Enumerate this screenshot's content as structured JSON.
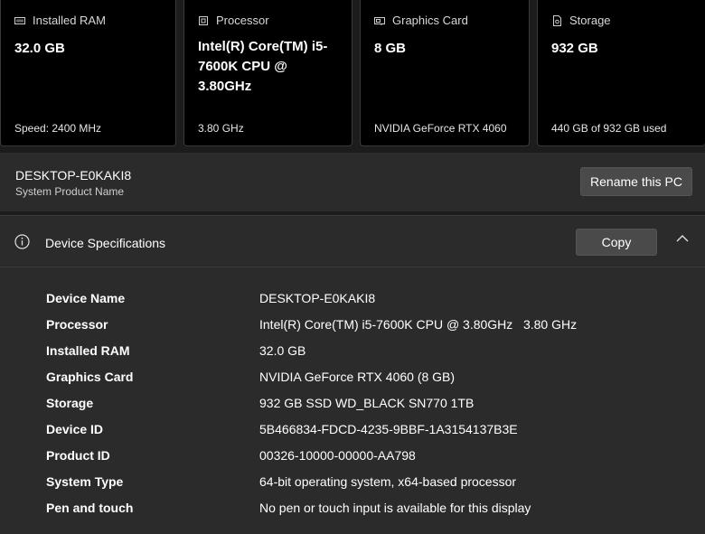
{
  "cards": [
    {
      "icon": "ram-icon",
      "title": "Installed RAM",
      "value": "32.0 GB",
      "footer": "Speed: 2400 MHz"
    },
    {
      "icon": "processor-icon",
      "title": "Processor",
      "value": "Intel(R) Core(TM) i5-7600K CPU @ 3.80GHz",
      "footer": "3.80 GHz"
    },
    {
      "icon": "graphics-card-icon",
      "title": "Graphics Card",
      "value": "8 GB",
      "footer": "NVIDIA GeForce RTX 4060"
    },
    {
      "icon": "storage-icon",
      "title": "Storage",
      "value": "932 GB",
      "footer": "440 GB of 932 GB used"
    }
  ],
  "pc": {
    "name": "DESKTOP-E0KAKI8",
    "subtitle": "System Product Name",
    "rename_label": "Rename this PC"
  },
  "specs": {
    "icon": "info-icon",
    "title": "Device Specifications",
    "copy_label": "Copy",
    "collapse_icon": "chevron-up-icon",
    "rows": [
      {
        "key": "Device Name",
        "value": "DESKTOP-E0KAKI8"
      },
      {
        "key": "Processor",
        "value": "Intel(R) Core(TM) i5-7600K CPU @ 3.80GHz   3.80 GHz"
      },
      {
        "key": "Installed RAM",
        "value": "32.0 GB"
      },
      {
        "key": "Graphics Card",
        "value": "NVIDIA GeForce RTX 4060 (8 GB)"
      },
      {
        "key": "Storage",
        "value": "932 GB SSD WD_BLACK SN770 1TB"
      },
      {
        "key": "Device ID",
        "value": "5B466834-FDCD-4235-9BBF-1A3154137B3E"
      },
      {
        "key": "Product ID",
        "value": "00326-10000-00000-AA798"
      },
      {
        "key": "System Type",
        "value": "64-bit operating system, x64-based processor"
      },
      {
        "key": "Pen and touch",
        "value": "No pen or touch input is available for this display"
      }
    ]
  },
  "colors": {
    "background": "#1c1c1c",
    "card": "#000000",
    "panel": "#2b2b2b",
    "button": "#4a4a4a",
    "text": "#ffffff"
  }
}
